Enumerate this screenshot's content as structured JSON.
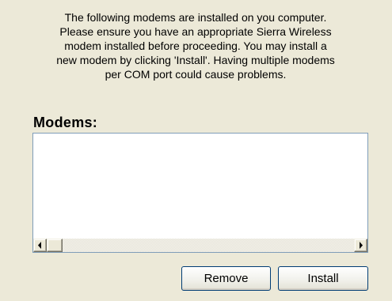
{
  "intro": {
    "lines": [
      "The following modems are installed on you computer.",
      "Please ensure you have an appropriate Sierra Wireless",
      "modem installed before proceeding. You may install a",
      "new modem by clicking 'Install'. Having multiple modems",
      "per COM port could cause problems."
    ]
  },
  "modems": {
    "label": "Modems:",
    "items": [],
    "scrollbar": {
      "left_icon": "scroll-left-arrow-icon",
      "right_icon": "scroll-right-arrow-icon"
    }
  },
  "buttons": {
    "remove_label": "Remove",
    "install_label": "Install"
  },
  "colors": {
    "background": "#ece9d8",
    "list_border": "#7f9db9",
    "button_border": "#003c74"
  }
}
